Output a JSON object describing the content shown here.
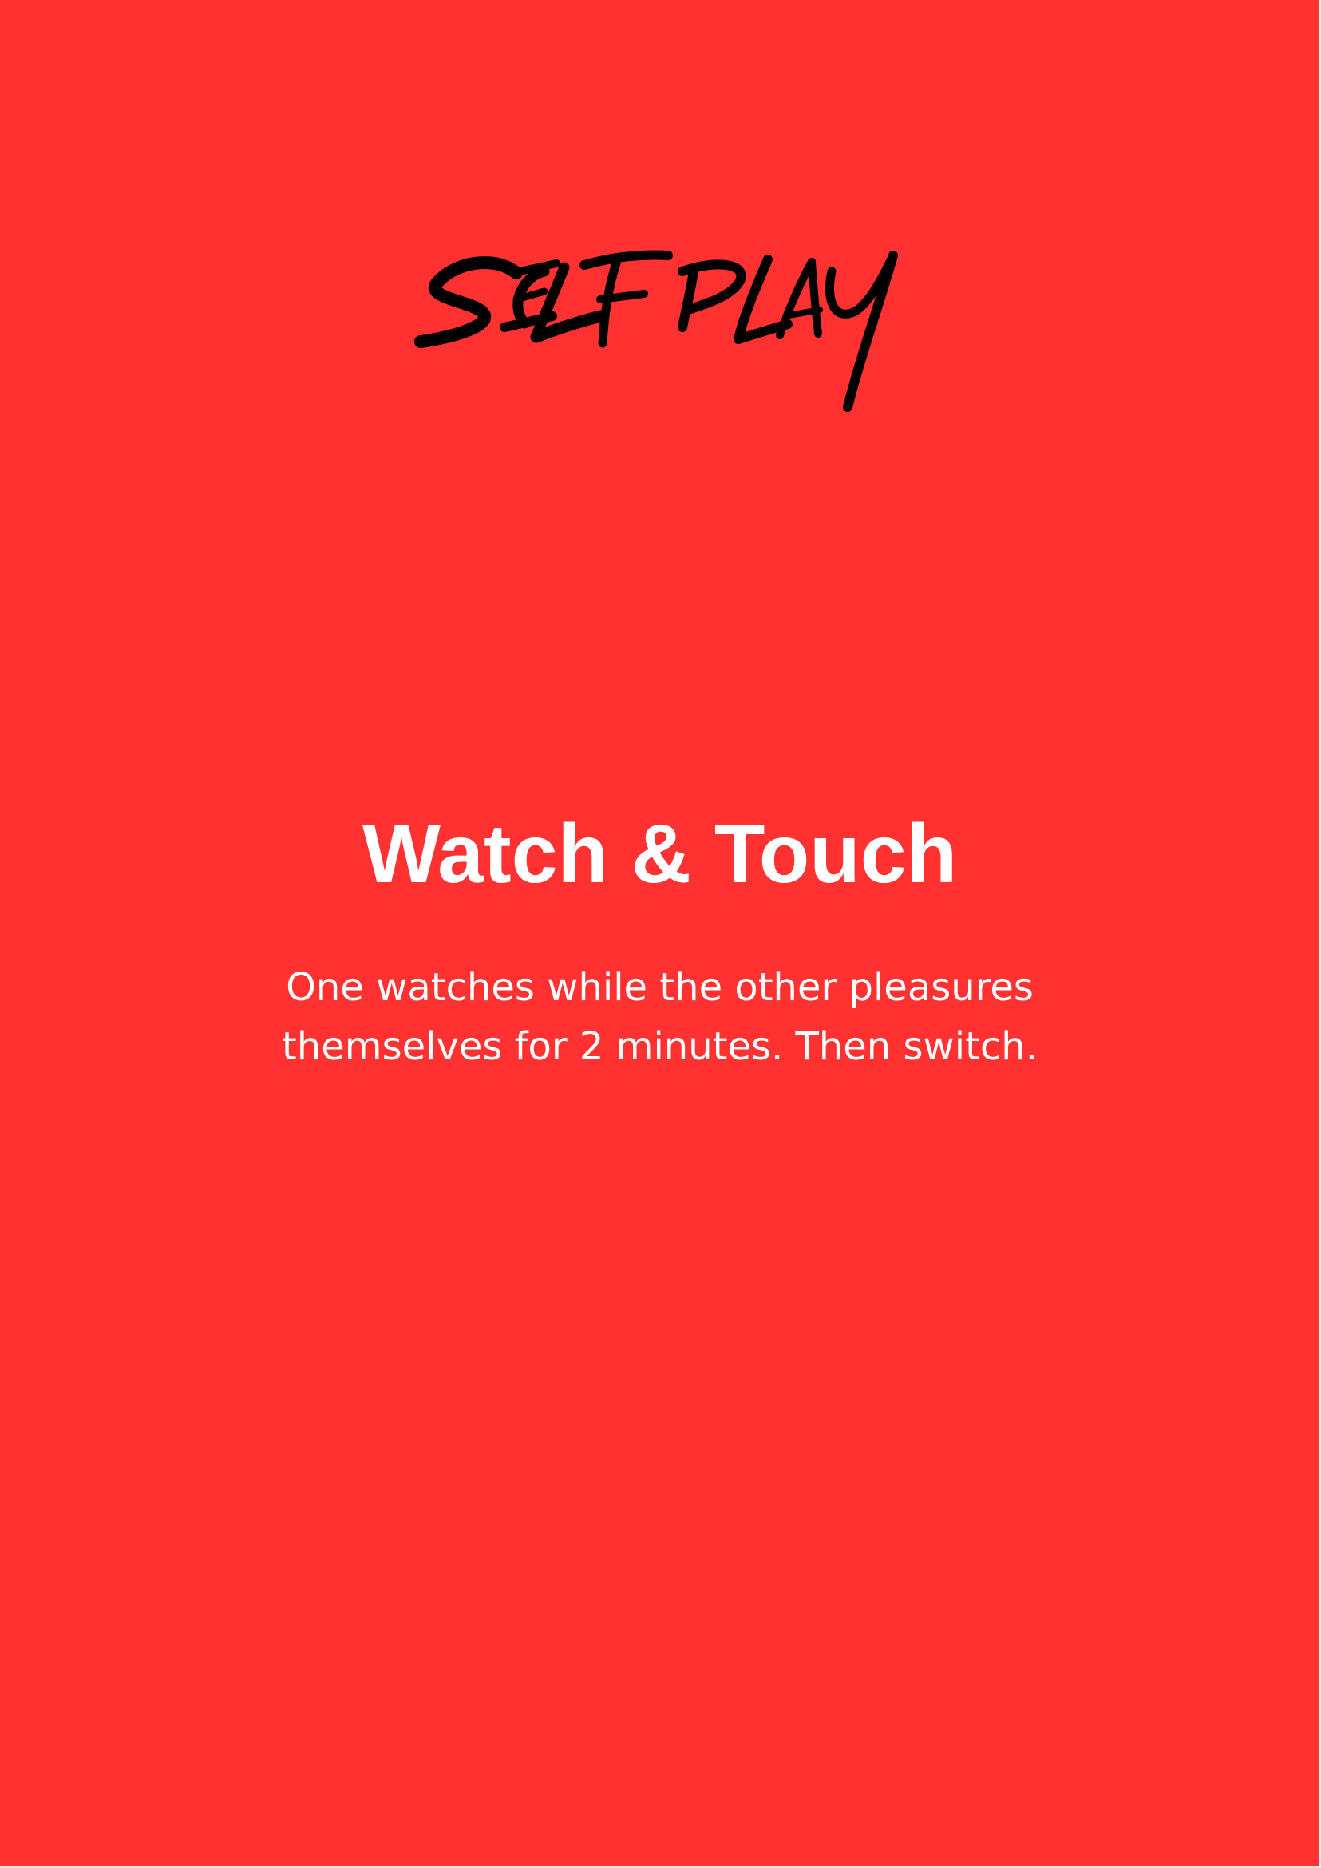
{
  "card": {
    "category": "SELF PLAY",
    "title": "Watch & Touch",
    "description": [
      "One watches while the other pleasures",
      "themselves for 2 minutes. Then switch."
    ]
  },
  "colors": {
    "background": "#ff3131",
    "title_text": "#ffffff",
    "body_text": "#ffffff",
    "category_text": "#000000"
  }
}
